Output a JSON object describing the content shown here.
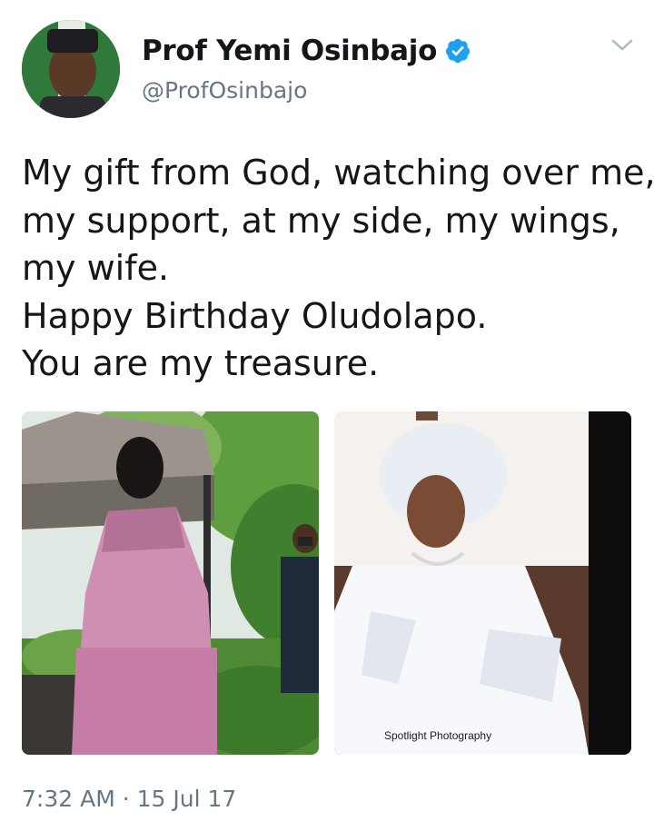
{
  "tweet": {
    "author": {
      "display_name": "Prof Yemi Osinbajo",
      "handle": "@ProfOsinbajo",
      "verified": true,
      "avatar_icon": "profile-photo"
    },
    "menu_icon": "chevron-down-icon",
    "text_lines": [
      "My gift from God, watching over me,",
      "my support, at my side, my wings,",
      "my wife.",
      "Happy Birthday Oludolapo.",
      "You are my treasure."
    ],
    "media": {
      "photo_credit": "Spotlight Photography"
    },
    "timestamp": "7:32 AM · 15 Jul 17"
  },
  "colors": {
    "text_primary": "#14171a",
    "text_secondary": "#657786",
    "verified_blue": "#1da1f2"
  }
}
